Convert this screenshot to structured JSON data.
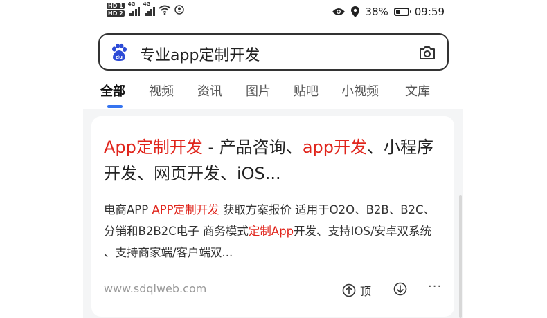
{
  "status_bar": {
    "hd1": "HD 1",
    "hd2": "HD 2",
    "net1": "4G",
    "net2": "4G",
    "battery_percent": "38%",
    "battery_level": 0.38,
    "time": "09:59"
  },
  "search": {
    "query": "专业app定制开发"
  },
  "tabs": [
    {
      "label": "全部",
      "active": true
    },
    {
      "label": "视频"
    },
    {
      "label": "资讯"
    },
    {
      "label": "图片"
    },
    {
      "label": "贴吧"
    },
    {
      "label": "小视频"
    },
    {
      "label": "文库"
    }
  ],
  "result": {
    "title_part1": "App定制开发",
    "title_part2": " - 产品咨询、",
    "title_part3": "app开发",
    "title_part4": "、小程序开发、网页开发、iOS...",
    "snippet_part1": "电商APP ",
    "snippet_part2": "APP定制开发",
    "snippet_part3": " 获取方案报价 适用于O2O、B2B、B2C、分销和B2B2C电子 商务模式",
    "snippet_part4": "定制App",
    "snippet_part5": "开发、支持IOS/安卓双系统 、支持商家端/客户端双...",
    "site": "www.sdqlweb.com",
    "up_label": "顶",
    "more": "···"
  },
  "colors": {
    "highlight": "#e0241b",
    "accent": "#3574f0",
    "baidu_blue": "#2d4bd6"
  }
}
